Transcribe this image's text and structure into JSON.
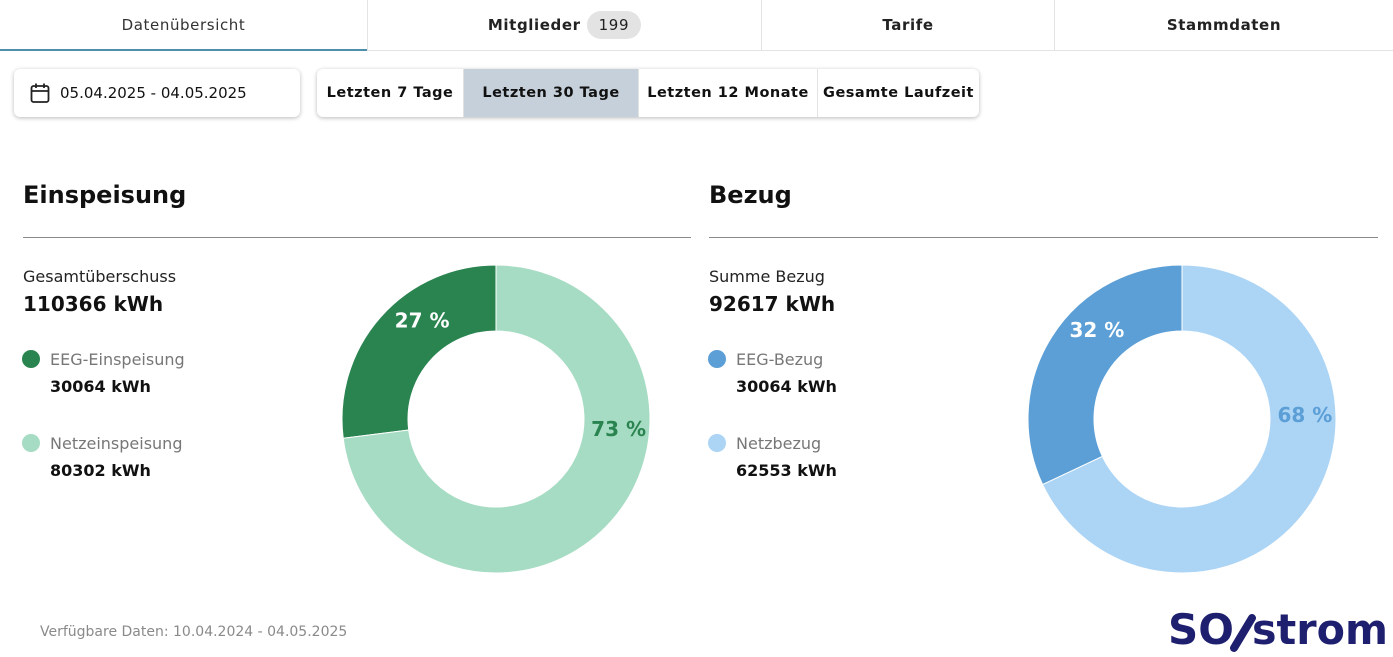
{
  "tabs": [
    {
      "label": "Datenübersicht",
      "active": true
    },
    {
      "label": "Mitglieder",
      "badge": "199"
    },
    {
      "label": "Tarife"
    },
    {
      "label": "Stammdaten"
    }
  ],
  "date_range": {
    "value": "05.04.2025 - 04.05.2025",
    "icon": "calendar-icon"
  },
  "range_buttons": [
    {
      "label": "Letzten 7 Tage"
    },
    {
      "label": "Letzten 30 Tage",
      "selected": true
    },
    {
      "label": "Letzten 12 Monate"
    },
    {
      "label": "Gesamte Laufzeit"
    }
  ],
  "einspeisung": {
    "title": "Einspeisung",
    "total_label": "Gesamtüberschuss",
    "total_value": "110366 kWh",
    "legend": [
      {
        "name": "EEG-Einspeisung",
        "value": "30064 kWh",
        "color": "#2a8450"
      },
      {
        "name": "Netzeinspeisung",
        "value": "80302 kWh",
        "color": "#a6dcc3"
      }
    ],
    "chart": {
      "slices": [
        {
          "percent": 27,
          "label": "27 %",
          "color": "#2a8450",
          "text_color": "#ffffff"
        },
        {
          "percent": 73,
          "label": "73 %",
          "color": "#a6dcc3",
          "text_color": "#2a8450"
        }
      ]
    }
  },
  "bezug": {
    "title": "Bezug",
    "total_label": "Summe Bezug",
    "total_value": "92617 kWh",
    "legend": [
      {
        "name": "EEG-Bezug",
        "value": "30064 kWh",
        "color": "#5b9fd6"
      },
      {
        "name": "Netzbezug",
        "value": "62553 kWh",
        "color": "#acd4f5"
      }
    ],
    "chart": {
      "slices": [
        {
          "percent": 32,
          "label": "32 %",
          "color": "#5b9fd6",
          "text_color": "#ffffff"
        },
        {
          "percent": 68,
          "label": "68 %",
          "color": "#acd4f5",
          "text_color": "#5b9fd6"
        }
      ]
    }
  },
  "footer": {
    "text": "Verfügbare Daten: 10.04.2024 - 04.05.2025"
  },
  "logo": {
    "text": "SOLstrom",
    "color": "#1e1f6e"
  }
}
